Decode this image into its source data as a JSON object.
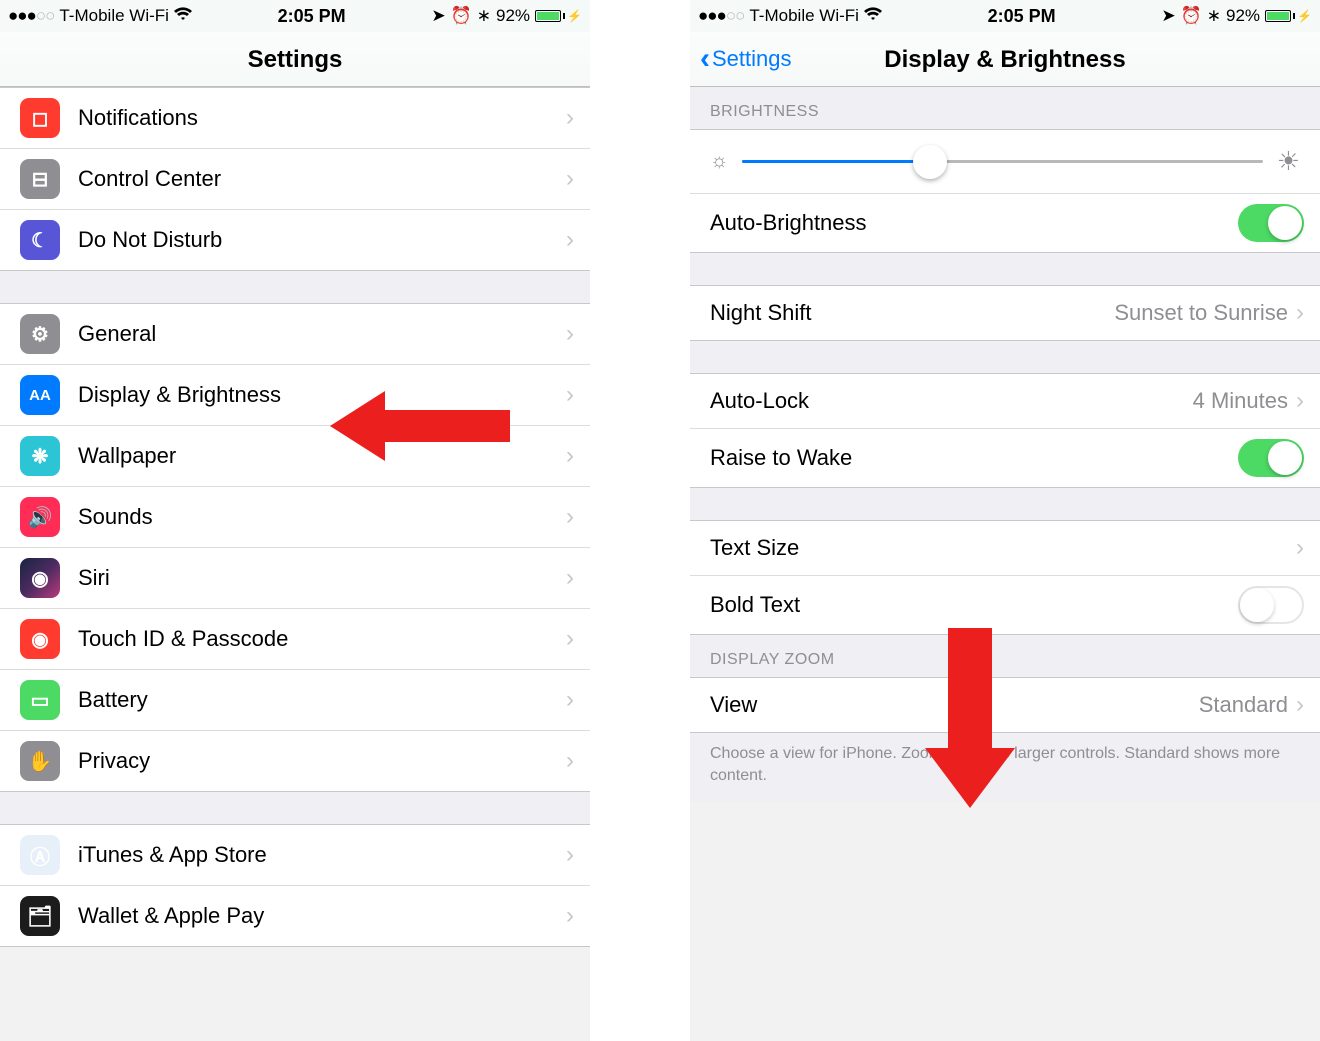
{
  "status": {
    "carrier": "T-Mobile Wi-Fi",
    "time": "2:05 PM",
    "battery_pct": "92%"
  },
  "left": {
    "title": "Settings",
    "groups": [
      {
        "items": [
          {
            "id": "notifications",
            "label": "Notifications",
            "iconClass": "bg-red",
            "icon": "notifications-icon",
            "glyph": "◻"
          },
          {
            "id": "control-center",
            "label": "Control Center",
            "iconClass": "bg-gray",
            "icon": "control-center-icon",
            "glyph": "⊟"
          },
          {
            "id": "do-not-disturb",
            "label": "Do Not Disturb",
            "iconClass": "bg-moon",
            "icon": "moon-icon",
            "glyph": "☾"
          }
        ]
      },
      {
        "items": [
          {
            "id": "general",
            "label": "General",
            "iconClass": "bg-gear",
            "icon": "gear-icon",
            "glyph": "⚙"
          },
          {
            "id": "display",
            "label": "Display & Brightness",
            "iconClass": "bg-blue",
            "icon": "text-size-icon",
            "glyph": "AA"
          },
          {
            "id": "wallpaper",
            "label": "Wallpaper",
            "iconClass": "bg-cyan",
            "icon": "wallpaper-icon",
            "glyph": "❋"
          },
          {
            "id": "sounds",
            "label": "Sounds",
            "iconClass": "bg-pink",
            "icon": "sounds-icon",
            "glyph": "🔊"
          },
          {
            "id": "siri",
            "label": "Siri",
            "iconClass": "bg-siri",
            "icon": "siri-icon",
            "glyph": "◉"
          },
          {
            "id": "touchid",
            "label": "Touch ID & Passcode",
            "iconClass": "bg-touch",
            "icon": "fingerprint-icon",
            "glyph": "◉"
          },
          {
            "id": "battery",
            "label": "Battery",
            "iconClass": "bg-green",
            "icon": "battery-icon",
            "glyph": "▭"
          },
          {
            "id": "privacy",
            "label": "Privacy",
            "iconClass": "bg-hand",
            "icon": "hand-icon",
            "glyph": "✋"
          }
        ]
      },
      {
        "items": [
          {
            "id": "itunes",
            "label": "iTunes & App Store",
            "iconClass": "bg-store",
            "icon": "app-store-icon",
            "glyph": "Ⓐ"
          },
          {
            "id": "wallet",
            "label": "Wallet & Apple Pay",
            "iconClass": "bg-wallet",
            "icon": "wallet-icon",
            "glyph": "🗂"
          }
        ]
      }
    ]
  },
  "right": {
    "back": "Settings",
    "title": "Display & Brightness",
    "brightness_header": "BRIGHTNESS",
    "brightness_value": 0.36,
    "auto_brightness": {
      "label": "Auto-Brightness",
      "on": true
    },
    "night_shift": {
      "label": "Night Shift",
      "detail": "Sunset to Sunrise"
    },
    "auto_lock": {
      "label": "Auto-Lock",
      "detail": "4 Minutes"
    },
    "raise_wake": {
      "label": "Raise to Wake",
      "on": true
    },
    "text_size": {
      "label": "Text Size"
    },
    "bold_text": {
      "label": "Bold Text",
      "on": false
    },
    "zoom_header": "DISPLAY ZOOM",
    "view": {
      "label": "View",
      "detail": "Standard"
    },
    "zoom_footer": "Choose a view for iPhone. Zoomed shows larger controls. Standard shows more content."
  }
}
